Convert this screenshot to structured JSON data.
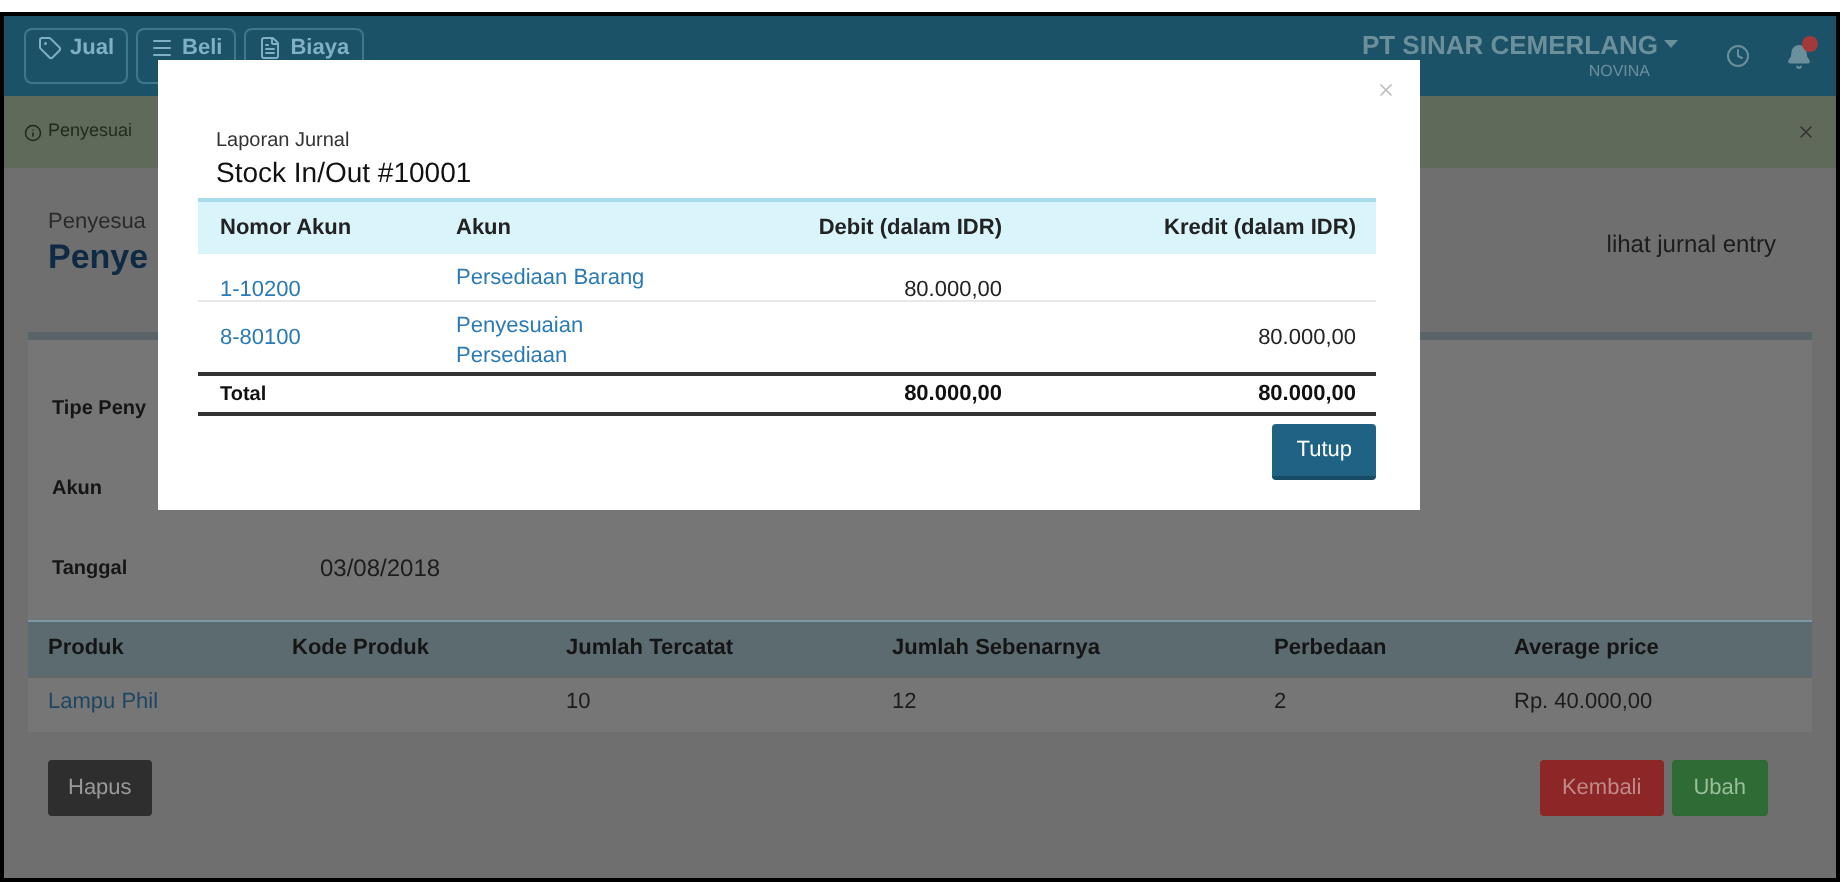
{
  "navbar": {
    "buttons": [
      {
        "label": "Jual",
        "kind": "tag"
      },
      {
        "label": "Beli",
        "kind": "list"
      },
      {
        "label": "Biaya",
        "kind": "doc"
      }
    ],
    "company": "PT SINAR CEMERLANG",
    "user": "NOVINA",
    "notification": true
  },
  "alert": {
    "text": "Penyesuai"
  },
  "header": {
    "subtitle": "Penyesua",
    "title": "Penye",
    "link": "lihat jurnal entry"
  },
  "details": [
    {
      "label": "Tipe Peny"
    },
    {
      "label": "Akun"
    },
    {
      "label": "Tanggal",
      "value": "03/08/2018"
    }
  ],
  "products": {
    "columns": [
      "Produk",
      "Kode Produk",
      "Jumlah Tercatat",
      "Jumlah Sebenarnya",
      "Perbedaan",
      "Average price"
    ],
    "rows": [
      [
        "Lampu Phil",
        "",
        "10",
        "12",
        "2",
        "Rp. 40.000,00"
      ]
    ]
  },
  "actions": {
    "delete": "Hapus",
    "back": "Kembali",
    "edit": "Ubah"
  },
  "modal": {
    "subtitle": "Laporan Jurnal",
    "title": "Stock In/Out #10001",
    "columns": [
      "Nomor Akun",
      "Akun",
      "Debit (dalam IDR)",
      "Kredit (dalam IDR)"
    ],
    "rows": [
      {
        "number": "1-10200",
        "account": [
          "Persediaan Barang"
        ],
        "debit": "80.000,00",
        "credit": ""
      },
      {
        "number": "8-80100",
        "account": [
          "Penyesuaian",
          "Persediaan"
        ],
        "debit": "",
        "credit": "80.000,00"
      }
    ],
    "total": {
      "label": "Total",
      "debit": "80.000,00",
      "credit": "80.000,00"
    },
    "close_button": "Tutup"
  }
}
